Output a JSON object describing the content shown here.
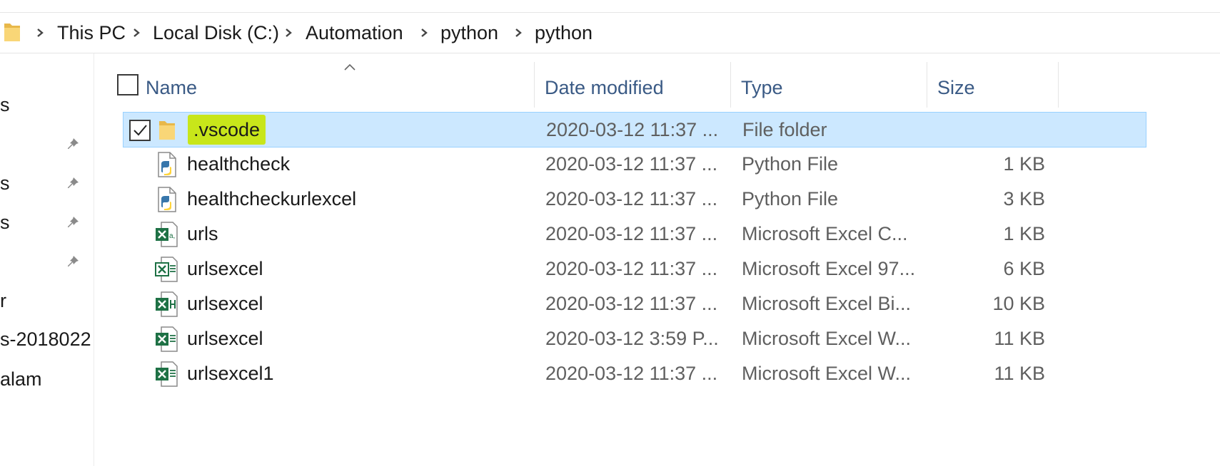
{
  "breadcrumb": {
    "items": [
      "This PC",
      "Local Disk (C:)",
      "Automation",
      "python",
      "python"
    ]
  },
  "nav_pane": {
    "items": [
      "s",
      "",
      "s",
      "s",
      "",
      "r",
      "s-2018022",
      "alam"
    ]
  },
  "columns": {
    "name": "Name",
    "date_modified": "Date modified",
    "type": "Type",
    "size": "Size"
  },
  "files": [
    {
      "name": ".vscode",
      "date": "2020-03-12 11:37 ...",
      "type": "File folder",
      "size": "",
      "icon": "folder-icon",
      "selected": true
    },
    {
      "name": "healthcheck",
      "date": "2020-03-12 11:37 ...",
      "type": "Python File",
      "size": "1 KB",
      "icon": "python-file-icon",
      "selected": false
    },
    {
      "name": "healthcheckurlexcel",
      "date": "2020-03-12 11:37 ...",
      "type": "Python File",
      "size": "3 KB",
      "icon": "python-file-icon",
      "selected": false
    },
    {
      "name": "urls",
      "date": "2020-03-12 11:37 ...",
      "type": "Microsoft Excel C...",
      "size": "1 KB",
      "icon": "excel-csv-icon",
      "selected": false
    },
    {
      "name": "urlsexcel",
      "date": "2020-03-12 11:37 ...",
      "type": "Microsoft Excel 97...",
      "size": "6 KB",
      "icon": "excel-97-icon",
      "selected": false
    },
    {
      "name": "urlsexcel",
      "date": "2020-03-12 11:37 ...",
      "type": "Microsoft Excel Bi...",
      "size": "10 KB",
      "icon": "excel-binary-icon",
      "selected": false
    },
    {
      "name": "urlsexcel",
      "date": "2020-03-12 3:59 P...",
      "type": "Microsoft Excel W...",
      "size": "11 KB",
      "icon": "excel-workbook-icon",
      "selected": false
    },
    {
      "name": "urlsexcel1",
      "date": "2020-03-12 11:37 ...",
      "type": "Microsoft Excel W...",
      "size": "11 KB",
      "icon": "excel-workbook-icon",
      "selected": false
    }
  ],
  "colors": {
    "selection_bg": "#cce8ff",
    "selection_border": "#99d1ff",
    "highlight": "#c8e61a",
    "header_text": "#3a5a85",
    "excel_green": "#1e7145"
  }
}
